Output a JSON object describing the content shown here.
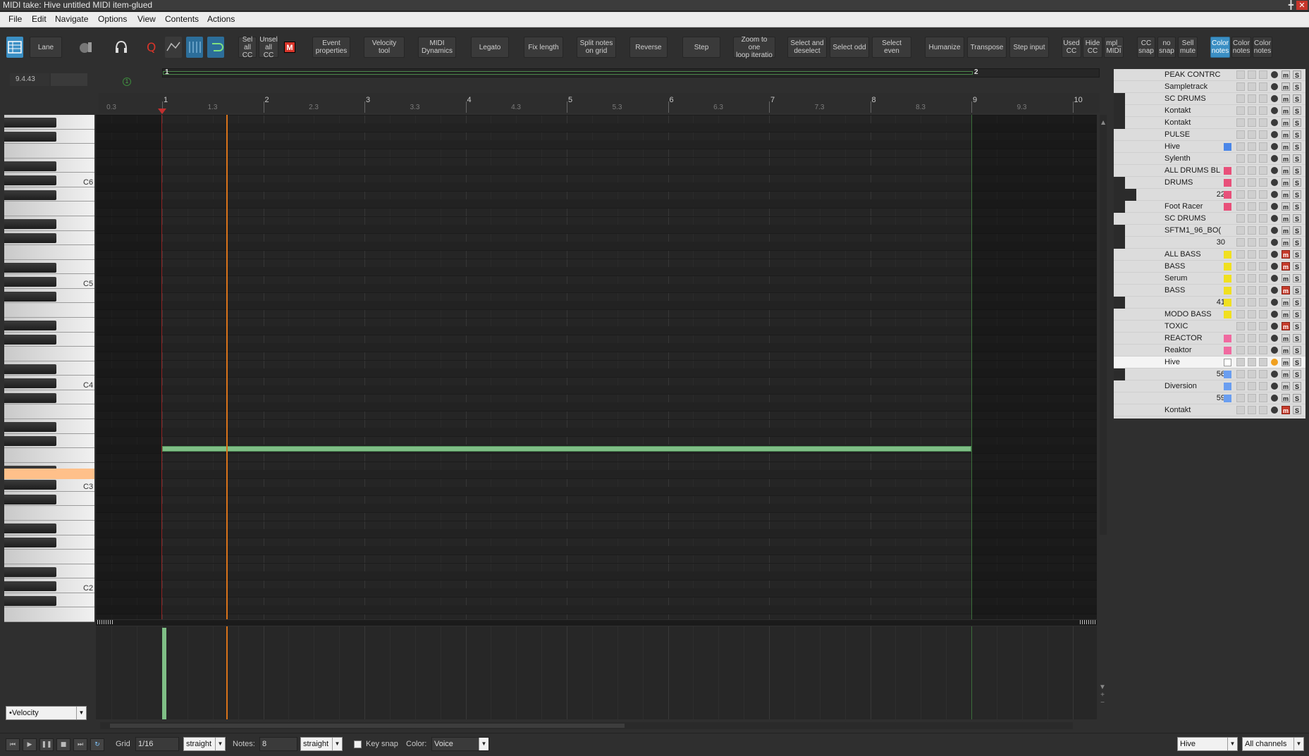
{
  "window": {
    "title": "MIDI take: Hive untitled MIDI item-glued",
    "pin": "╋",
    "close": "✕"
  },
  "menu": [
    "File",
    "Edit",
    "Navigate",
    "Options",
    "View",
    "Contents",
    "Actions"
  ],
  "toolbar": {
    "lane_label": "Lane",
    "m_label": "M",
    "buttons": [
      {
        "id": "sel-all-cc",
        "label": "Sel\nall CC"
      },
      {
        "id": "unsel-all-cc",
        "label": "Unsel\nall CC"
      },
      {
        "id": "event-properties",
        "label": "Event\nproperties"
      },
      {
        "id": "velocity-tool",
        "label": "Velocity tool"
      },
      {
        "id": "midi-dynamics",
        "label": "MIDI\nDynamics"
      },
      {
        "id": "legato",
        "label": "Legato"
      },
      {
        "id": "fix-length",
        "label": "Fix length"
      },
      {
        "id": "split-notes",
        "label": "Split notes\non grid"
      },
      {
        "id": "reverse",
        "label": "Reverse"
      },
      {
        "id": "step",
        "label": "Step"
      },
      {
        "id": "zoom-loop",
        "label": "Zoom to one\nloop iteratio"
      },
      {
        "id": "select-deselect",
        "label": "Select and\ndeselect"
      },
      {
        "id": "select-odd",
        "label": "Select odd"
      },
      {
        "id": "select-even",
        "label": "Select even"
      },
      {
        "id": "humanize",
        "label": "Humanize"
      },
      {
        "id": "transpose",
        "label": "Transpose"
      },
      {
        "id": "step-input",
        "label": "Step input"
      },
      {
        "id": "used-cc",
        "label": "Used\nCC"
      },
      {
        "id": "hide-cc",
        "label": "Hide\nCC"
      },
      {
        "id": "mpl-midi",
        "label": "mpl_\nMIDI"
      },
      {
        "id": "cc-snap",
        "label": "CC\nsnap"
      },
      {
        "id": "no-snap",
        "label": "no\nsnap"
      },
      {
        "id": "sell-mute",
        "label": "Sell\nmute"
      },
      {
        "id": "color-notes-1",
        "label": "Color\nnotes"
      },
      {
        "id": "color-notes-2",
        "label": "Color\nnotes"
      },
      {
        "id": "color-notes-3",
        "label": "Color\nnotes"
      }
    ]
  },
  "position": "9.4.43",
  "loop_markers": [
    "1",
    "2"
  ],
  "marker_icon": "1",
  "ruler": {
    "major": [
      "1",
      "2",
      "3",
      "4",
      "5",
      "6",
      "7",
      "8",
      "9",
      "10"
    ],
    "minor": [
      "0.3",
      "1.3",
      "2.3",
      "3.3",
      "4.3",
      "5.3",
      "6.3",
      "7.3",
      "8.3",
      "9.3"
    ]
  },
  "keyboard_labels": [
    "C6",
    "C5",
    "C4",
    "C3",
    "C2"
  ],
  "cc_lane": {
    "selected": "•Velocity"
  },
  "bottom": {
    "grid_label": "Grid",
    "grid_value": "1/16",
    "grid_mode": "straight",
    "notes_label": "Notes:",
    "notes_value": "8",
    "notes_mode": "straight",
    "key_snap": "Key snap",
    "color_label": "Color:",
    "color_value": "Voice",
    "track": "Hive",
    "channels": "All channels"
  },
  "tracks": [
    {
      "name": "PEAK CONTRC",
      "color": "",
      "mute": false
    },
    {
      "name": "Sampletrack",
      "color": "",
      "mute": false
    },
    {
      "name": "SC DRUMS",
      "color": "",
      "mute": false
    },
    {
      "name": "Kontakt",
      "color": "",
      "mute": false
    },
    {
      "name": "Kontakt",
      "color": "",
      "mute": false
    },
    {
      "name": "PULSE",
      "color": "",
      "mute": false
    },
    {
      "name": "Hive",
      "color": "#4a86e8",
      "mute": false
    },
    {
      "name": "Sylenth",
      "color": "",
      "mute": false
    },
    {
      "name": "ALL DRUMS BL",
      "color": "#e8507a",
      "mute": false
    },
    {
      "name": "DRUMS",
      "color": "#e8507a",
      "mute": false
    },
    {
      "name": "22",
      "color": "#e8507a",
      "mute": false,
      "num": true
    },
    {
      "name": "Foot Racer",
      "color": "#e8507a",
      "mute": false
    },
    {
      "name": "SC DRUMS",
      "color": "",
      "mute": false
    },
    {
      "name": "SFTM1_96_BO(",
      "color": "",
      "mute": false
    },
    {
      "name": "30",
      "color": "",
      "mute": false,
      "num": true
    },
    {
      "name": "ALL BASS",
      "color": "#f0e020",
      "mute": true
    },
    {
      "name": "BASS",
      "color": "#f0e020",
      "mute": true
    },
    {
      "name": "Serum",
      "color": "#f0e020",
      "mute": false
    },
    {
      "name": "BASS",
      "color": "#f0e020",
      "mute": true
    },
    {
      "name": "41",
      "color": "#f0e020",
      "mute": false,
      "num": true
    },
    {
      "name": "MODO BASS",
      "color": "#f0e020",
      "mute": false
    },
    {
      "name": "TOXIC",
      "color": "",
      "mute": true
    },
    {
      "name": "REACTOR",
      "color": "#f06aa0",
      "mute": false
    },
    {
      "name": "Reaktor",
      "color": "#f06aa0",
      "mute": false
    },
    {
      "name": "Hive",
      "color": "#ffffff",
      "mute": false,
      "selected": true
    },
    {
      "name": "56",
      "color": "#6a9ef0",
      "mute": false,
      "num": true
    },
    {
      "name": "Diversion",
      "color": "#6a9ef0",
      "mute": false
    },
    {
      "name": "59",
      "color": "#6a9ef0",
      "mute": false,
      "num": true
    },
    {
      "name": "Kontakt",
      "color": "",
      "mute": true
    }
  ]
}
